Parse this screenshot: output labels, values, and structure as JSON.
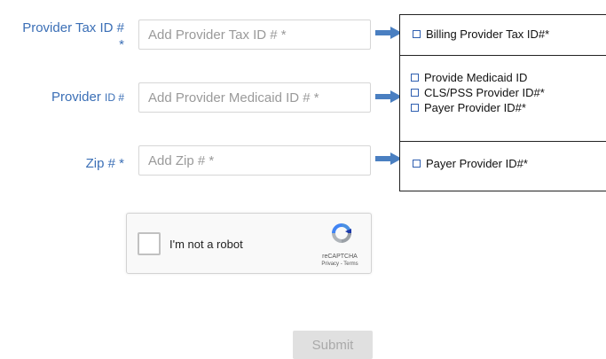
{
  "form": {
    "tax_id": {
      "label": "Provider Tax ID #",
      "label_star": "*",
      "placeholder": "Add Provider Tax ID # *"
    },
    "provider_id": {
      "label_main": "Provider",
      "label_small": "ID #",
      "placeholder": "Add Provider Medicaid ID # *"
    },
    "zip": {
      "label": "Zip # *",
      "placeholder": "Add Zip # *"
    }
  },
  "annotations": {
    "tax_id_box": [
      "Billing Provider Tax ID#*"
    ],
    "provider_id_box": [
      "Provide Medicaid ID",
      "CLS/PSS Provider ID#*",
      "Payer Provider ID#*"
    ],
    "zip_box": [
      "Payer Provider ID#*"
    ]
  },
  "captcha": {
    "label": "I'm not a robot",
    "brand": "reCAPTCHA",
    "links": "Privacy - Terms",
    "logo_icon": "recaptcha-logo-icon"
  },
  "submit_label": "Submit",
  "colors": {
    "label_blue": "#3b6fb6",
    "arrow_blue": "#4a7fc1",
    "checkbox_blue": "#2f5fb0",
    "submit_bg": "#e0e0e0"
  }
}
